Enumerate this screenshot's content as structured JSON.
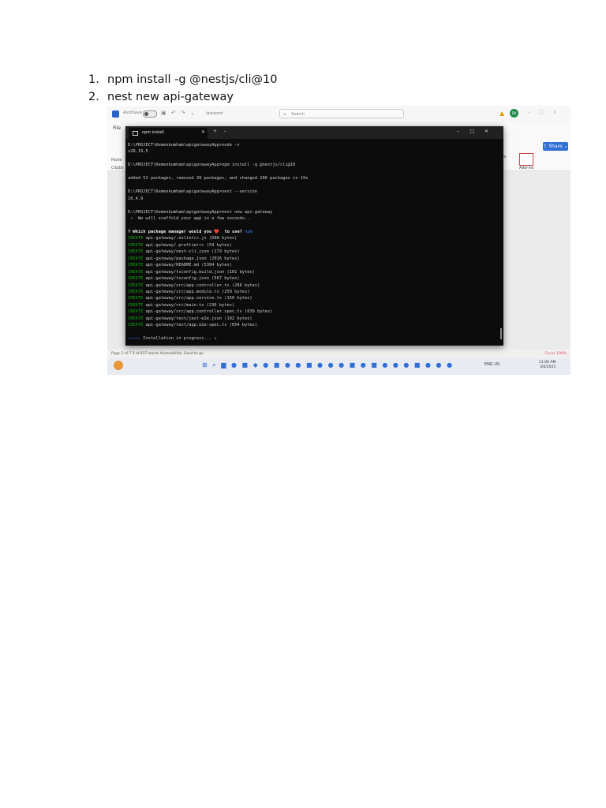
{
  "steps": [
    {
      "num": "1.",
      "text": "npm install -g @nestjs/cli@10"
    },
    {
      "num": "2.",
      "text": "nest new api-gateway"
    }
  ],
  "word": {
    "autosave": "AutoSave",
    "doc_name": "lastword",
    "search_placeholder": "Search",
    "avatar": "DK",
    "file_tab": "File",
    "share": "Share",
    "rb_left": [
      "Paste",
      "Clipbo"
    ],
    "rb_right": "date",
    "rb_addin": "Add-ins",
    "rb_bottom": "Sensitive   Add-ins",
    "status_left": "Page 2 of 7    3 of 837 words    Accessibility: Good to go",
    "status_right": "Focus     100%",
    "tray_lang": "ENG US",
    "time": "11:06 AM",
    "date": "3/6/2025"
  },
  "terminal": {
    "tab_title": "npm install",
    "lines": [
      {
        "t": "D:\\PROJECT\\Kemenkumham\\apigatewayApp>node -v"
      },
      {
        "t": "v20.19.5"
      },
      {
        "t": ""
      },
      {
        "t": "D:\\PROJECT\\Kemenkumham\\apigatewayApp>npm install -g @nestjs/cli@10"
      },
      {
        "t": ""
      },
      {
        "t": "added 52 packages, removed 39 packages, and changed 206 packages in 19s"
      },
      {
        "t": ""
      },
      {
        "t": "D:\\PROJECT\\Kemenkumham\\apigatewayApp>nest --version"
      },
      {
        "t": "10.4.9"
      },
      {
        "t": ""
      },
      {
        "t": "D:\\PROJECT\\Kemenkumham\\apigatewayApp>nest new api-gateway"
      },
      {
        "t": " ⚡  We will scaffold your app in a few seconds.."
      },
      {
        "t": ""
      },
      {
        "q": "? Which package manager would you ❤️  to use? ",
        "a": "npm"
      },
      {
        "c": "CREATE",
        "t": " api-gateway/.eslintrc.js (688 bytes)"
      },
      {
        "c": "CREATE",
        "t": " api-gateway/.prettierrc (54 bytes)"
      },
      {
        "c": "CREATE",
        "t": " api-gateway/nest-cli.json (179 bytes)"
      },
      {
        "c": "CREATE",
        "t": " api-gateway/package.json (2016 bytes)"
      },
      {
        "c": "CREATE",
        "t": " api-gateway/README.md (5304 bytes)"
      },
      {
        "c": "CREATE",
        "t": " api-gateway/tsconfig.build.json (101 bytes)"
      },
      {
        "c": "CREATE",
        "t": " api-gateway/tsconfig.json (567 bytes)"
      },
      {
        "c": "CREATE",
        "t": " api-gateway/src/app.controller.ts (286 bytes)"
      },
      {
        "c": "CREATE",
        "t": " api-gateway/src/app.module.ts (259 bytes)"
      },
      {
        "c": "CREATE",
        "t": " api-gateway/src/app.service.ts (150 bytes)"
      },
      {
        "c": "CREATE",
        "t": " api-gateway/src/main.ts (236 bytes)"
      },
      {
        "c": "CREATE",
        "t": " api-gateway/src/app.controller.spec.ts (639 bytes)"
      },
      {
        "c": "CREATE",
        "t": " api-gateway/test/jest-e2e.json (192 bytes)"
      },
      {
        "c": "CREATE",
        "t": " api-gateway/test/app.e2e-spec.ts (654 bytes)"
      },
      {
        "t": ""
      },
      {
        "p": "▹▹▹▹▹",
        "t": " Installation in progress... ☕"
      }
    ]
  }
}
